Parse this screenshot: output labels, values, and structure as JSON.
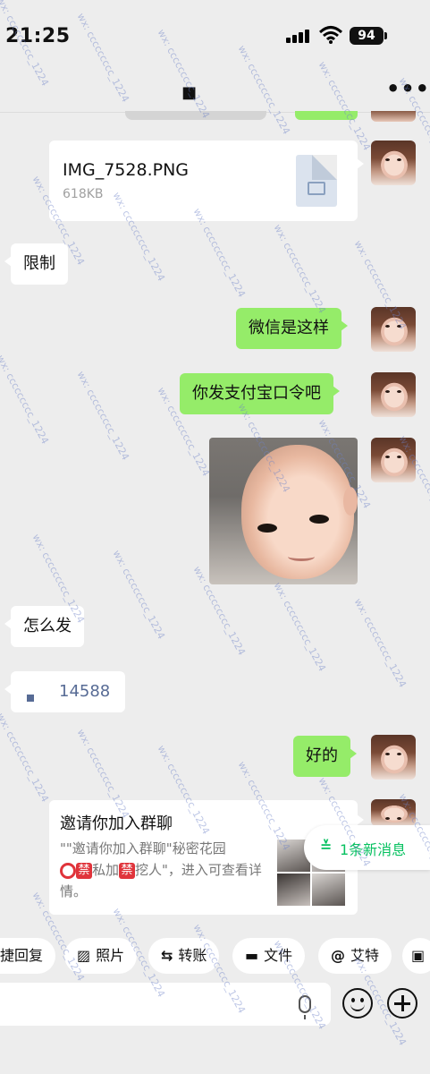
{
  "status_bar": {
    "time": "21:25",
    "battery": "94"
  },
  "nav": {
    "title": "■",
    "more": "•••"
  },
  "messages": [
    {
      "type": "file",
      "side": "right",
      "file_name": "IMG_7528.PNG",
      "file_size": "618KB"
    },
    {
      "type": "text",
      "side": "left",
      "text": "限制"
    },
    {
      "type": "text",
      "side": "right",
      "text": "微信是这样"
    },
    {
      "type": "text",
      "side": "right",
      "text": "你发支付宝口令吧"
    },
    {
      "type": "image",
      "side": "right"
    },
    {
      "type": "text",
      "side": "left",
      "text": "怎么发"
    },
    {
      "type": "text",
      "side": "left",
      "text": "14588"
    },
    {
      "type": "text",
      "side": "right",
      "text": "好的"
    },
    {
      "type": "group_invite",
      "side": "right",
      "title": "邀请你加入群聊",
      "desc_1": "\"\"邀请你加入群聊\"秘密花园",
      "badge_ring": "",
      "badge_1": "禁",
      "desc_2": "私加",
      "badge_2": "禁",
      "desc_3": "挖人\"，进入可查看详情。"
    }
  ],
  "new_messages": {
    "label": "1条新消息"
  },
  "quick_actions": [
    {
      "label": "捷回复"
    },
    {
      "label": "照片"
    },
    {
      "label": "转账"
    },
    {
      "label": "文件"
    },
    {
      "label": "艾特"
    }
  ],
  "watermark": "wx: ccccccccc_1224"
}
